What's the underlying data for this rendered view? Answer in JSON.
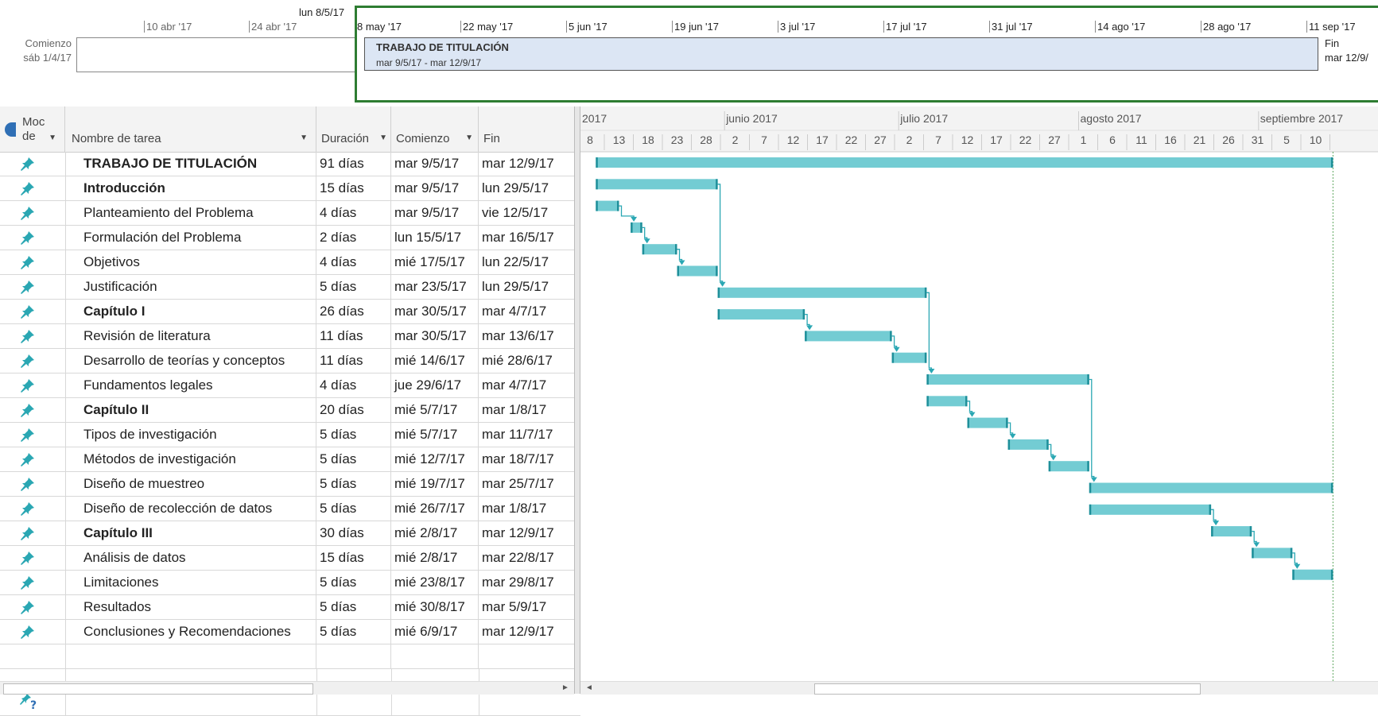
{
  "timeline": {
    "today_label": "lun 8/5/17",
    "start_caption": "Comienzo",
    "start_date": "sáb 1/4/17",
    "end_caption": "Fin",
    "end_date": "mar 12/9/",
    "bar_title": "TRABAJO DE TITULACIÓN",
    "bar_dates": "mar 9/5/17 - mar 12/9/17",
    "ticks": [
      "10 abr '17",
      "24 abr '17",
      "8 may '17",
      "22 may '17",
      "5 jun '17",
      "19 jun '17",
      "3 jul '17",
      "17 jul '17",
      "31 jul '17",
      "14 ago '17",
      "28 ago '17",
      "11 sep '17"
    ],
    "frame_color": "#2e7d32",
    "bar_color": "#dce6f4"
  },
  "table": {
    "headers": {
      "mode": "Moc de",
      "name": "Nombre de tarea",
      "duration": "Duración",
      "start": "Comienzo",
      "end": "Fin"
    },
    "tasks": [
      {
        "name": "TRABAJO DE TITULACIÓN",
        "duration": "91 días",
        "start": "mar 9/5/17",
        "end": "mar 12/9/17",
        "bold": true
      },
      {
        "name": "Introducción",
        "duration": "15 días",
        "start": "mar 9/5/17",
        "end": "lun 29/5/17",
        "bold": true
      },
      {
        "name": "Planteamiento del Problema",
        "duration": "4 días",
        "start": "mar 9/5/17",
        "end": "vie 12/5/17",
        "bold": false
      },
      {
        "name": "Formulación del Problema",
        "duration": "2 días",
        "start": "lun 15/5/17",
        "end": "mar 16/5/17",
        "bold": false
      },
      {
        "name": "Objetivos",
        "duration": "4 días",
        "start": "mié 17/5/17",
        "end": "lun 22/5/17",
        "bold": false
      },
      {
        "name": "Justificación",
        "duration": "5 días",
        "start": "mar 23/5/17",
        "end": "lun 29/5/17",
        "bold": false
      },
      {
        "name": "Capítulo I",
        "duration": "26 días",
        "start": "mar 30/5/17",
        "end": "mar 4/7/17",
        "bold": true
      },
      {
        "name": "Revisión de literatura",
        "duration": "11 días",
        "start": "mar 30/5/17",
        "end": "mar 13/6/17",
        "bold": false
      },
      {
        "name": "Desarrollo de teorías y conceptos",
        "duration": "11 días",
        "start": "mié 14/6/17",
        "end": "mié 28/6/17",
        "bold": false
      },
      {
        "name": "Fundamentos legales",
        "duration": "4 días",
        "start": "jue 29/6/17",
        "end": "mar 4/7/17",
        "bold": false
      },
      {
        "name": "Capítulo II",
        "duration": "20 días",
        "start": "mié 5/7/17",
        "end": "mar 1/8/17",
        "bold": true
      },
      {
        "name": "Tipos de investigación",
        "duration": "5 días",
        "start": "mié 5/7/17",
        "end": "mar 11/7/17",
        "bold": false
      },
      {
        "name": "Métodos de investigación",
        "duration": "5 días",
        "start": "mié 12/7/17",
        "end": "mar 18/7/17",
        "bold": false
      },
      {
        "name": "Diseño de muestreo",
        "duration": "5 días",
        "start": "mié 19/7/17",
        "end": "mar 25/7/17",
        "bold": false
      },
      {
        "name": "Diseño de recolección de datos",
        "duration": "5 días",
        "start": "mié 26/7/17",
        "end": "mar 1/8/17",
        "bold": false
      },
      {
        "name": "Capítulo III",
        "duration": "30 días",
        "start": "mié 2/8/17",
        "end": "mar 12/9/17",
        "bold": true
      },
      {
        "name": "Análisis de datos",
        "duration": "15 días",
        "start": "mié 2/8/17",
        "end": "mar 22/8/17",
        "bold": false
      },
      {
        "name": "Limitaciones",
        "duration": "5 días",
        "start": "mié 23/8/17",
        "end": "mar 29/8/17",
        "bold": false
      },
      {
        "name": "Resultados",
        "duration": "5 días",
        "start": "mié 30/8/17",
        "end": "mar 5/9/17",
        "bold": false
      },
      {
        "name": "Conclusiones y Recomendaciones",
        "duration": "5 días",
        "start": "mié 6/9/17",
        "end": "mar 12/9/17",
        "bold": false
      }
    ],
    "mode_icon": "pushpin-icon",
    "new_task_icon": "pushpin-question-icon"
  },
  "gantt": {
    "months": [
      "2017",
      "junio 2017",
      "julio 2017",
      "agosto 2017",
      "septiembre 2017"
    ],
    "days": [
      "8",
      "13",
      "18",
      "23",
      "28",
      "2",
      "7",
      "12",
      "17",
      "22",
      "27",
      "2",
      "7",
      "12",
      "17",
      "22",
      "27",
      "1",
      "6",
      "11",
      "16",
      "21",
      "26",
      "31",
      "5",
      "10"
    ],
    "bar_color": "#73ccd3",
    "arrow_color": "#2aa7b3",
    "day0": "2017-05-08",
    "bars": [
      {
        "start": "2017-05-09",
        "end": "2017-09-12"
      },
      {
        "start": "2017-05-09",
        "end": "2017-05-29"
      },
      {
        "start": "2017-05-09",
        "end": "2017-05-12"
      },
      {
        "start": "2017-05-15",
        "end": "2017-05-16"
      },
      {
        "start": "2017-05-17",
        "end": "2017-05-22"
      },
      {
        "start": "2017-05-23",
        "end": "2017-05-29"
      },
      {
        "start": "2017-05-30",
        "end": "2017-07-04"
      },
      {
        "start": "2017-05-30",
        "end": "2017-06-13"
      },
      {
        "start": "2017-06-14",
        "end": "2017-06-28"
      },
      {
        "start": "2017-06-29",
        "end": "2017-07-04"
      },
      {
        "start": "2017-07-05",
        "end": "2017-08-01"
      },
      {
        "start": "2017-07-05",
        "end": "2017-07-11"
      },
      {
        "start": "2017-07-12",
        "end": "2017-07-18"
      },
      {
        "start": "2017-07-19",
        "end": "2017-07-25"
      },
      {
        "start": "2017-07-26",
        "end": "2017-08-01"
      },
      {
        "start": "2017-08-02",
        "end": "2017-09-12"
      },
      {
        "start": "2017-08-02",
        "end": "2017-08-22"
      },
      {
        "start": "2017-08-23",
        "end": "2017-08-29"
      },
      {
        "start": "2017-08-30",
        "end": "2017-09-05"
      },
      {
        "start": "2017-09-06",
        "end": "2017-09-12"
      }
    ],
    "links": [
      [
        2,
        3
      ],
      [
        3,
        4
      ],
      [
        4,
        5
      ],
      [
        1,
        6
      ],
      [
        7,
        8
      ],
      [
        8,
        9
      ],
      [
        6,
        10
      ],
      [
        11,
        12
      ],
      [
        12,
        13
      ],
      [
        13,
        14
      ],
      [
        10,
        15
      ],
      [
        16,
        17
      ],
      [
        17,
        18
      ],
      [
        18,
        19
      ]
    ]
  }
}
